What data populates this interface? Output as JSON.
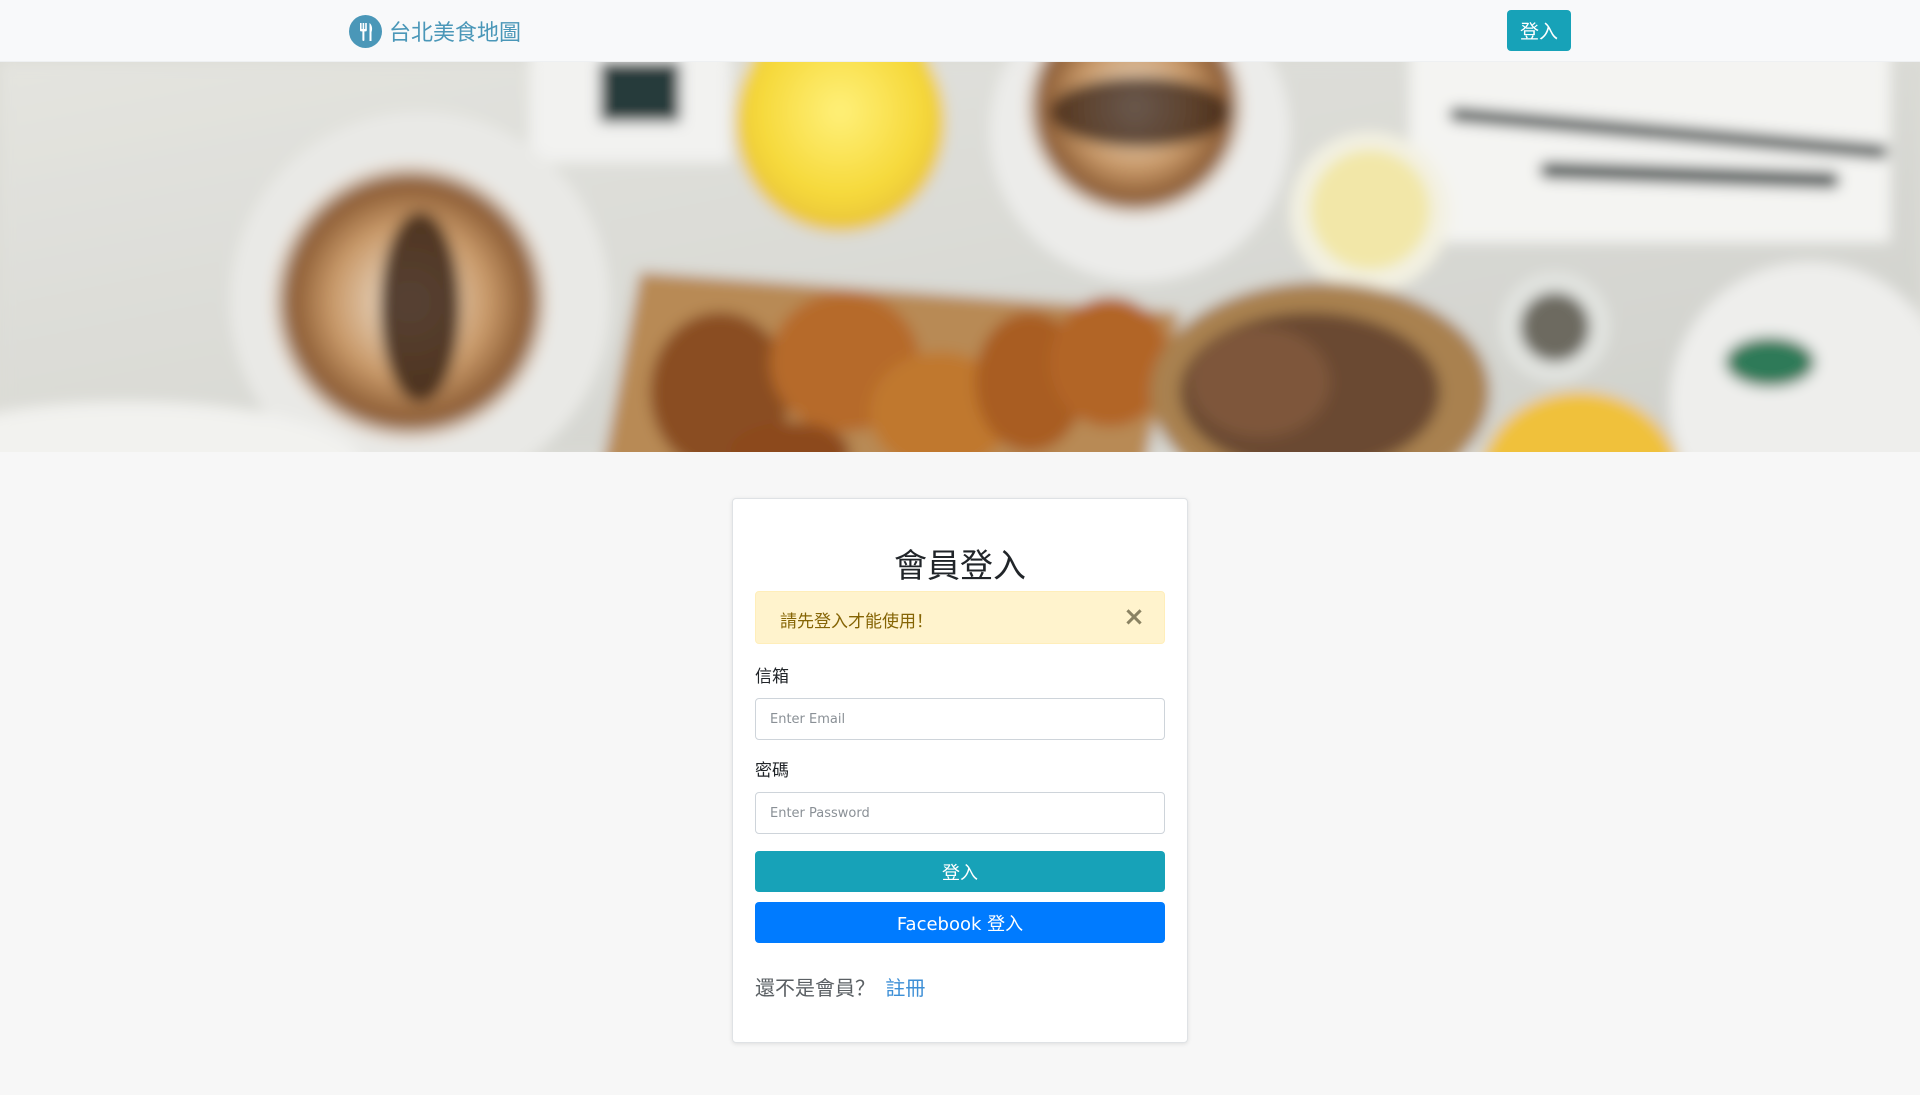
{
  "navbar": {
    "brand_name": "台北美食地圖",
    "brand_icon": "fork-knife-icon",
    "login_button": "登入"
  },
  "hero": {
    "image": "blurred breakfast table background"
  },
  "login_card": {
    "title": "會員登入",
    "alert": {
      "message": "請先登入才能使用！",
      "close_symbol": "×"
    },
    "email": {
      "label": "信箱",
      "placeholder": "Enter Email",
      "value": ""
    },
    "password": {
      "label": "密碼",
      "placeholder": "Enter Password",
      "value": ""
    },
    "submit_button": "登入",
    "facebook_button": "Facebook 登入",
    "register_prompt": "還不是會員？",
    "register_link": "註冊"
  },
  "colors": {
    "brand": "#4a97b8",
    "primary_teal": "#17a2b8",
    "facebook_blue": "#007bff",
    "alert_bg": "#fff3cd",
    "alert_text": "#856404",
    "page_bg": "#f7f7f7"
  }
}
